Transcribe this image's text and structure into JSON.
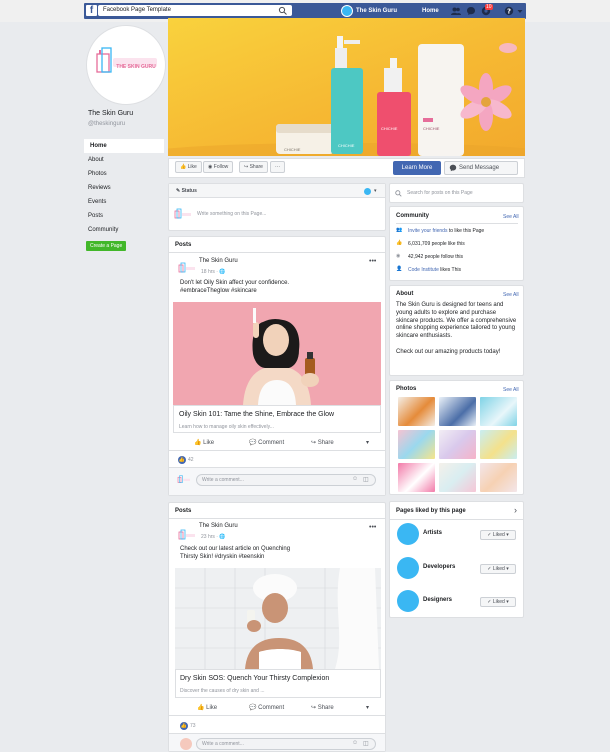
{
  "topbar": {
    "app_label": "Facebook Page Template",
    "page_name": "The Skin Guru",
    "home": "Home",
    "notifications_count": "10"
  },
  "profile": {
    "logo_text": "THE SKIN GURU",
    "name": "The Skin Guru",
    "handle": "@theskinguru"
  },
  "nav": {
    "items": [
      "Home",
      "About",
      "Photos",
      "Reviews",
      "Events",
      "Posts",
      "Community"
    ],
    "active": "Home",
    "create_page": "Create a Page"
  },
  "cover": {
    "bottle_labels": [
      "CHICHIE",
      "CHICHIE",
      "CHICHIE",
      "CHICHIE"
    ]
  },
  "actions": {
    "like": "Like",
    "follow": "Follow",
    "share": "Share",
    "more": "···",
    "learn_more": "Learn More",
    "send_message": "Send Message"
  },
  "status": {
    "label": "Status",
    "placeholder": "Write something on this Page..."
  },
  "right": {
    "search_placeholder": "Search for posts on this Page",
    "community": {
      "title": "Community",
      "see_all": "See All",
      "rows": [
        {
          "link": "Invite your friends",
          "text": " to like this Page"
        },
        {
          "link": "",
          "text": "6,031,709 people like this"
        },
        {
          "link": "",
          "text": "42,942 people follow this"
        },
        {
          "link": "Code Institute",
          "text": " likes This"
        }
      ]
    },
    "about": {
      "title": "About",
      "see_all": "See All",
      "text": "The Skin Guru is designed for teens and young adults to explore and purchase skincare products. We offer a comprehensive online shopping experience tailored to young skincare enthusiasts.",
      "text2": "Check out our amazing products today!"
    },
    "photos": {
      "title": "Photos",
      "see_all": "See All",
      "colors": [
        "#f4eee6",
        "#e8f0f6",
        "#7fd3e6",
        "#f5c3d2",
        "#e7d6f0",
        "#c9eef2",
        "#f27aa8",
        "#f4f0ea",
        "#f3e6ea"
      ]
    },
    "liked": {
      "title": "Pages liked by this page",
      "chevron": "›",
      "pages": [
        "Artists",
        "Developers",
        "Designers"
      ],
      "liked_label": "✓ Liked ▾"
    }
  },
  "posts": [
    {
      "section_title": "Posts",
      "author": "The Skin Guru",
      "time": "18 hrs",
      "caption_lines": [
        "Don't let Oily Skin affect your confidence.",
        "#embraceTheglow #skincare"
      ],
      "link_title": "Oily Skin 101: Tame the Shine, Embrace the Glow",
      "link_desc": "Learn how to manage oily skin effectively...",
      "like": "Like",
      "comment": "Comment",
      "share": "Share",
      "reactions": "42",
      "comment_placeholder": "Write a comment..."
    },
    {
      "section_title": "Posts",
      "author": "The Skin Guru",
      "time": "23 hrs",
      "caption_lines": [
        "Check out our latest article on Quenching",
        "Thirsty Skin! #dryskin #teenskin"
      ],
      "link_title": "Dry Skin SOS: Quench Your Thirsty Complexion",
      "link_desc": "Discover the causes of dry skin and ...",
      "like": "Like",
      "comment": "Comment",
      "share": "Share",
      "reactions": "73",
      "comment_placeholder": "Write a comment..."
    }
  ],
  "colors": {
    "fb_blue": "#3b5998",
    "accent": "#4267b2",
    "brand_cyan": "#3ab7f3",
    "green": "#42b72a"
  }
}
